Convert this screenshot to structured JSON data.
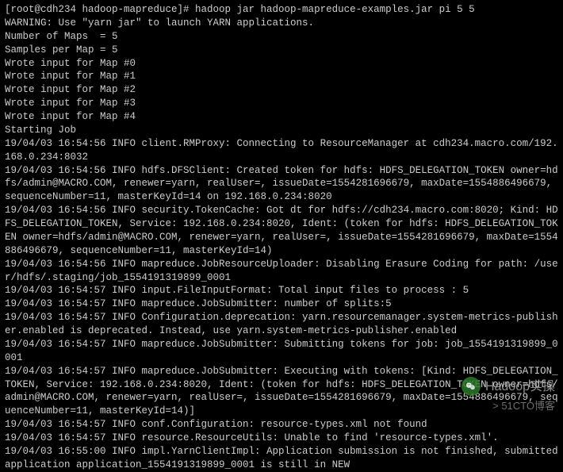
{
  "terminal": {
    "lines": [
      "[root@cdh234 hadoop-mapreduce]# hadoop jar hadoop-mapreduce-examples.jar pi 5 5",
      "WARNING: Use \"yarn jar\" to launch YARN applications.",
      "Number of Maps  = 5",
      "Samples per Map = 5",
      "Wrote input for Map #0",
      "Wrote input for Map #1",
      "Wrote input for Map #2",
      "Wrote input for Map #3",
      "Wrote input for Map #4",
      "Starting Job",
      "19/04/03 16:54:56 INFO client.RMProxy: Connecting to ResourceManager at cdh234.macro.com/192.168.0.234:8032",
      "19/04/03 16:54:56 INFO hdfs.DFSClient: Created token for hdfs: HDFS_DELEGATION_TOKEN owner=hdfs/admin@MACRO.COM, renewer=yarn, realUser=, issueDate=1554281696679, maxDate=1554886496679, sequenceNumber=11, masterKeyId=14 on 192.168.0.234:8020",
      "19/04/03 16:54:56 INFO security.TokenCache: Got dt for hdfs://cdh234.macro.com:8020; Kind: HDFS_DELEGATION_TOKEN, Service: 192.168.0.234:8020, Ident: (token for hdfs: HDFS_DELEGATION_TOKEN owner=hdfs/admin@MACRO.COM, renewer=yarn, realUser=, issueDate=1554281696679, maxDate=1554886496679, sequenceNumber=11, masterKeyId=14)",
      "19/04/03 16:54:56 INFO mapreduce.JobResourceUploader: Disabling Erasure Coding for path: /user/hdfs/.staging/job_1554191319899_0001",
      "19/04/03 16:54:57 INFO input.FileInputFormat: Total input files to process : 5",
      "19/04/03 16:54:57 INFO mapreduce.JobSubmitter: number of splits:5",
      "19/04/03 16:54:57 INFO Configuration.deprecation: yarn.resourcemanager.system-metrics-publisher.enabled is deprecated. Instead, use yarn.system-metrics-publisher.enabled",
      "19/04/03 16:54:57 INFO mapreduce.JobSubmitter: Submitting tokens for job: job_1554191319899_0001",
      "19/04/03 16:54:57 INFO mapreduce.JobSubmitter: Executing with tokens: [Kind: HDFS_DELEGATION_TOKEN, Service: 192.168.0.234:8020, Ident: (token for hdfs: HDFS_DELEGATION_TOKEN owner=hdfs/admin@MACRO.COM, renewer=yarn, realUser=, issueDate=1554281696679, maxDate=1554886496679, sequenceNumber=11, masterKeyId=14)]",
      "19/04/03 16:54:57 INFO conf.Configuration: resource-types.xml not found",
      "19/04/03 16:54:57 INFO resource.ResourceUtils: Unable to find 'resource-types.xml'.",
      "19/04/03 16:55:00 INFO impl.YarnClientImpl: Application submission is not finished, submitted application application_1554191319899_0001 is still in NEW"
    ]
  },
  "watermark": {
    "title": "Hadoop实操",
    "subtitle": "> 51CTO博客"
  }
}
